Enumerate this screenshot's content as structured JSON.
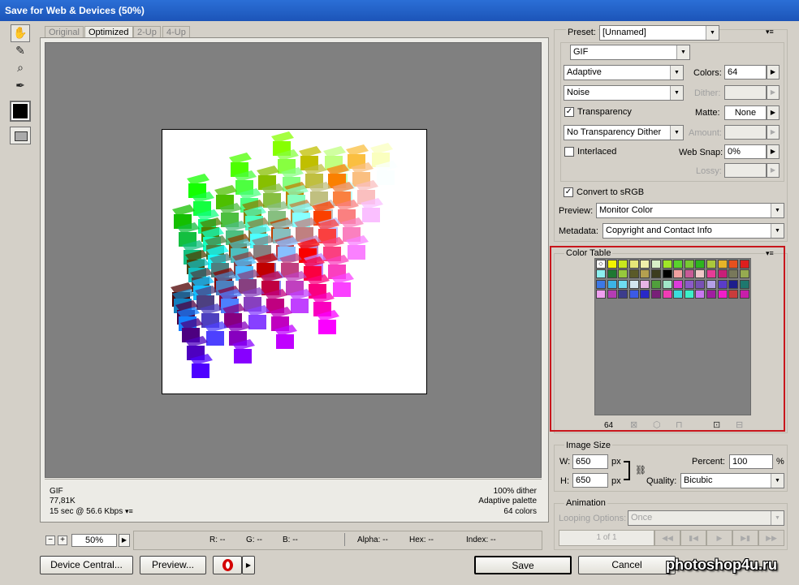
{
  "window": {
    "title": "Save for Web & Devices (50%)"
  },
  "tabs": [
    "Original",
    "Optimized",
    "2-Up",
    "4-Up"
  ],
  "info": {
    "format": "GIF",
    "size": "77,81K",
    "time": "15 sec @ 56.6 Kbps",
    "dither": "100% dither",
    "palette": "Adaptive palette",
    "colors": "64 colors"
  },
  "zoom": {
    "value": "50%"
  },
  "readouts": {
    "r": "R: --",
    "g": "G: --",
    "b": "B: --",
    "alpha": "Alpha: --",
    "hex": "Hex: --",
    "index": "Index: --"
  },
  "buttons": {
    "device_central": "Device Central...",
    "preview": "Preview...",
    "save": "Save",
    "cancel": "Cancel"
  },
  "settings": {
    "preset_label": "Preset:",
    "preset_value": "[Unnamed]",
    "format": "GIF",
    "reduction": "Adaptive",
    "colors_label": "Colors:",
    "colors_value": "64",
    "dither_algo": "Noise",
    "dither_label": "Dither:",
    "transparency_label": "Transparency",
    "transparency_checked": "✓",
    "matte_label": "Matte:",
    "matte_value": "None",
    "transp_dither": "No Transparency Dither",
    "amount_label": "Amount:",
    "interlaced_label": "Interlaced",
    "websnap_label": "Web Snap:",
    "websnap_value": "0%",
    "lossy_label": "Lossy:",
    "convert_label": "Convert to sRGB",
    "convert_checked": "✓",
    "preview_label": "Preview:",
    "preview_value": "Monitor Color",
    "metadata_label": "Metadata:",
    "metadata_value": "Copyright and Contact Info"
  },
  "color_table": {
    "title": "Color Table",
    "count": "64",
    "swatches": [
      "#ffffff",
      "#f2f200",
      "#c8e61e",
      "#e6e678",
      "#f0f0aa",
      "#d8f0c8",
      "#a0e628",
      "#5ad22d",
      "#78c832",
      "#2db41e",
      "#aac83c",
      "#e6b428",
      "#e6501e",
      "#dc1e1e",
      "#8cf0f0",
      "#1e7832",
      "#96c83c",
      "#5a5a28",
      "#b4a050",
      "#3c3c1e",
      "#000000",
      "#f0a0a0",
      "#c85a96",
      "#f0c8c8",
      "#e63c96",
      "#c81e78",
      "#78785a",
      "#96aa50",
      "#3c78e6",
      "#3cb4e6",
      "#6edcf0",
      "#d2e6f0",
      "#e6b4e6",
      "#50a03c",
      "#a0e6c8",
      "#dc3cdc",
      "#8c5ac8",
      "#7850b4",
      "#b4a0e6",
      "#5a3cc8",
      "#1e1e8c",
      "#1e786e",
      "#f0a0f0",
      "#b43cb4",
      "#3c3c8c",
      "#3c5ae6",
      "#2828c8",
      "#781e78",
      "#f03cb4",
      "#3cdcdc",
      "#3cf0c8",
      "#c878f0",
      "#a01ea0",
      "#f01ec8",
      "#c83c3c",
      "#c81eaa"
    ]
  },
  "image_size": {
    "title": "Image Size",
    "w_label": "W:",
    "w_value": "650",
    "h_label": "H:",
    "h_value": "650",
    "unit": "px",
    "percent_label": "Percent:",
    "percent_value": "100",
    "percent_unit": "%",
    "quality_label": "Quality:",
    "quality_value": "Bicubic"
  },
  "animation": {
    "title": "Animation",
    "looping_label": "Looping Options:",
    "looping_value": "Once",
    "frame": "1 of 1"
  },
  "watermark": "photoshop4u.ru"
}
